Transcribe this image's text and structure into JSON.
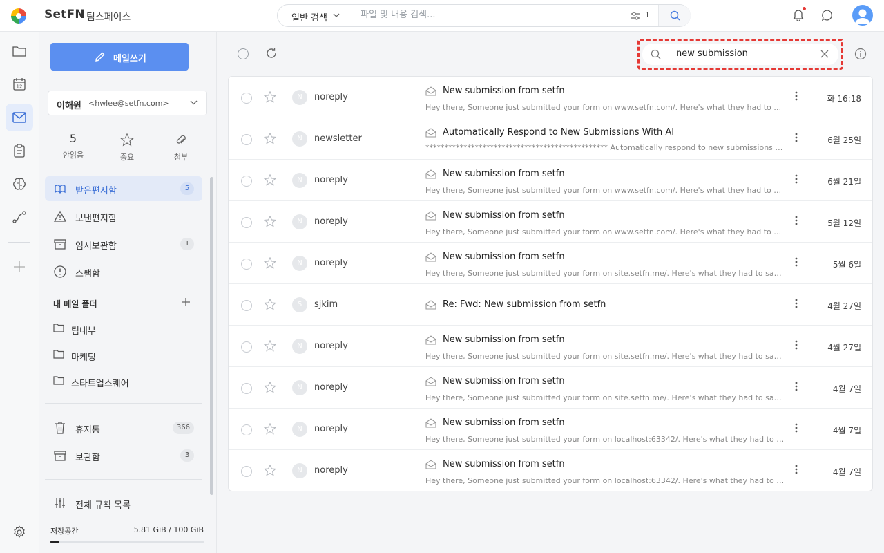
{
  "header": {
    "brand": "SetFN",
    "workspace": "팀스페이스",
    "search_type": "일반 검색",
    "search_placeholder": "파일 및 내용 검색...",
    "filter_count": "1"
  },
  "compose_label": "메일쓰기",
  "account": {
    "name": "이해원",
    "email": "<hwlee@setfn.com>"
  },
  "stats": {
    "unread_count": "5",
    "unread_label": "안읽음",
    "important_label": "중요",
    "attachment_label": "첨부"
  },
  "folders": [
    {
      "label": "받은편지함",
      "count": "5",
      "icon": "inbox-icon"
    },
    {
      "label": "보낸편지함",
      "count": "",
      "icon": "sent-icon"
    },
    {
      "label": "임시보관함",
      "count": "1",
      "icon": "drafts-icon"
    },
    {
      "label": "스팸함",
      "count": "",
      "icon": "spam-icon"
    }
  ],
  "my_folders_title": "내 메일 폴더",
  "my_folders": [
    "팀내부",
    "마케팅",
    "스타트업스퀘어"
  ],
  "system_folders": [
    {
      "label": "휴지통",
      "count": "366"
    },
    {
      "label": "보관함",
      "count": "3"
    }
  ],
  "rules_label": "전체 규칙 목록",
  "storage": {
    "label": "저장공간",
    "value": "5.81 GiB / 100 GiB",
    "used_fraction": 0.058
  },
  "mail_search": {
    "query": "new submission"
  },
  "emails": [
    {
      "avatar": "N",
      "sender": "noreply",
      "subject": "New submission from setfn",
      "preview": "Hey there, Someone just submitted your form on www.setfn.com/. Here's what they had to say: Name: 이해원 Email: hwlee@setfn.com",
      "date": "화 16:18"
    },
    {
      "avatar": "N",
      "sender": "newsletter",
      "subject": "Automatically Respond to New Submissions With AI",
      "preview": "************************************************ Automatically respond to new submissions with AI************************",
      "date": "6월 25일"
    },
    {
      "avatar": "N",
      "sender": "noreply",
      "subject": "New submission from setfn",
      "preview": "Hey there, Someone just submitted your form on www.setfn.com/. Here's what they had to say: Name: 이해원 Email: hwlee@setfn.com",
      "date": "6월 21일"
    },
    {
      "avatar": "N",
      "sender": "noreply",
      "subject": "New submission from setfn",
      "preview": "Hey there, Someone just submitted your form on www.setfn.com/. Here's what they had to say: Name: 이해원 Email: hwlee@setfn.com",
      "date": "5월 12일"
    },
    {
      "avatar": "N",
      "sender": "noreply",
      "subject": "New submission from setfn",
      "preview": "Hey there, Someone just submitted your form on site.setfn.me/. Here's what they had to say: name: 이해원 email: hwlee@setfn.com",
      "date": "5월 6일"
    },
    {
      "avatar": "S",
      "sender": "sjkim",
      "subject": "Re: Fwd: New submission from setfn",
      "preview": "",
      "date": "4월 27일"
    },
    {
      "avatar": "N",
      "sender": "noreply",
      "subject": "New submission from setfn",
      "preview": "Hey there, Someone just submitted your form on site.setfn.me/. Here's what they had to say: name: 이해원 email: hwlee@setfn.com",
      "date": "4월 27일"
    },
    {
      "avatar": "N",
      "sender": "noreply",
      "subject": "New submission from setfn",
      "preview": "Hey there, Someone just submitted your form on site.setfn.me/. Here's what they had to say: name: 이해원 email: hwlee@setfn.com",
      "date": "4월 7일"
    },
    {
      "avatar": "N",
      "sender": "noreply",
      "subject": "New submission from setfn",
      "preview": "Hey there, Someone just submitted your form on localhost:63342/. Here's what they had to say: name: 이해원 email: hwlee@setfn.com",
      "date": "4월 7일"
    },
    {
      "avatar": "N",
      "sender": "noreply",
      "subject": "New submission from setfn",
      "preview": "Hey there, Someone just submitted your form on localhost:63342/. Here's what they had to say: name: 이해원 email: hwlee@setfn.com",
      "date": "4월 7일"
    }
  ],
  "colors": {
    "accent": "#5b8ff0",
    "highlight_border": "#e53935",
    "active_folder_bg": "#e3eaf8"
  }
}
